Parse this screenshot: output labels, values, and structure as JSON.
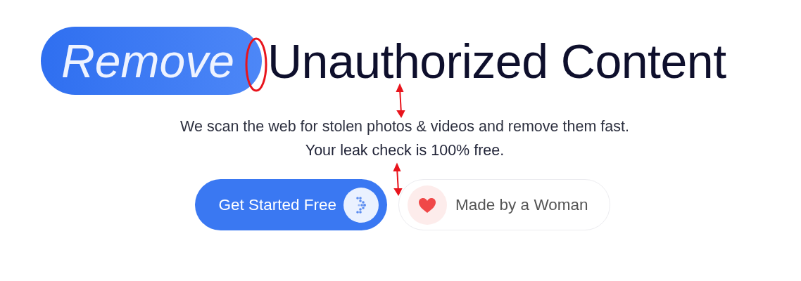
{
  "headline": {
    "highlight": "Remove",
    "rest": "Unauthorized Content"
  },
  "subtitle": [
    "We scan the web for stolen photos & videos and remove them fast.",
    "Your leak check is 100% free."
  ],
  "actions": [
    {
      "kind": "primary",
      "label": "Get Started Free"
    },
    {
      "kind": "badge",
      "label": "Made by a Woman"
    }
  ]
}
